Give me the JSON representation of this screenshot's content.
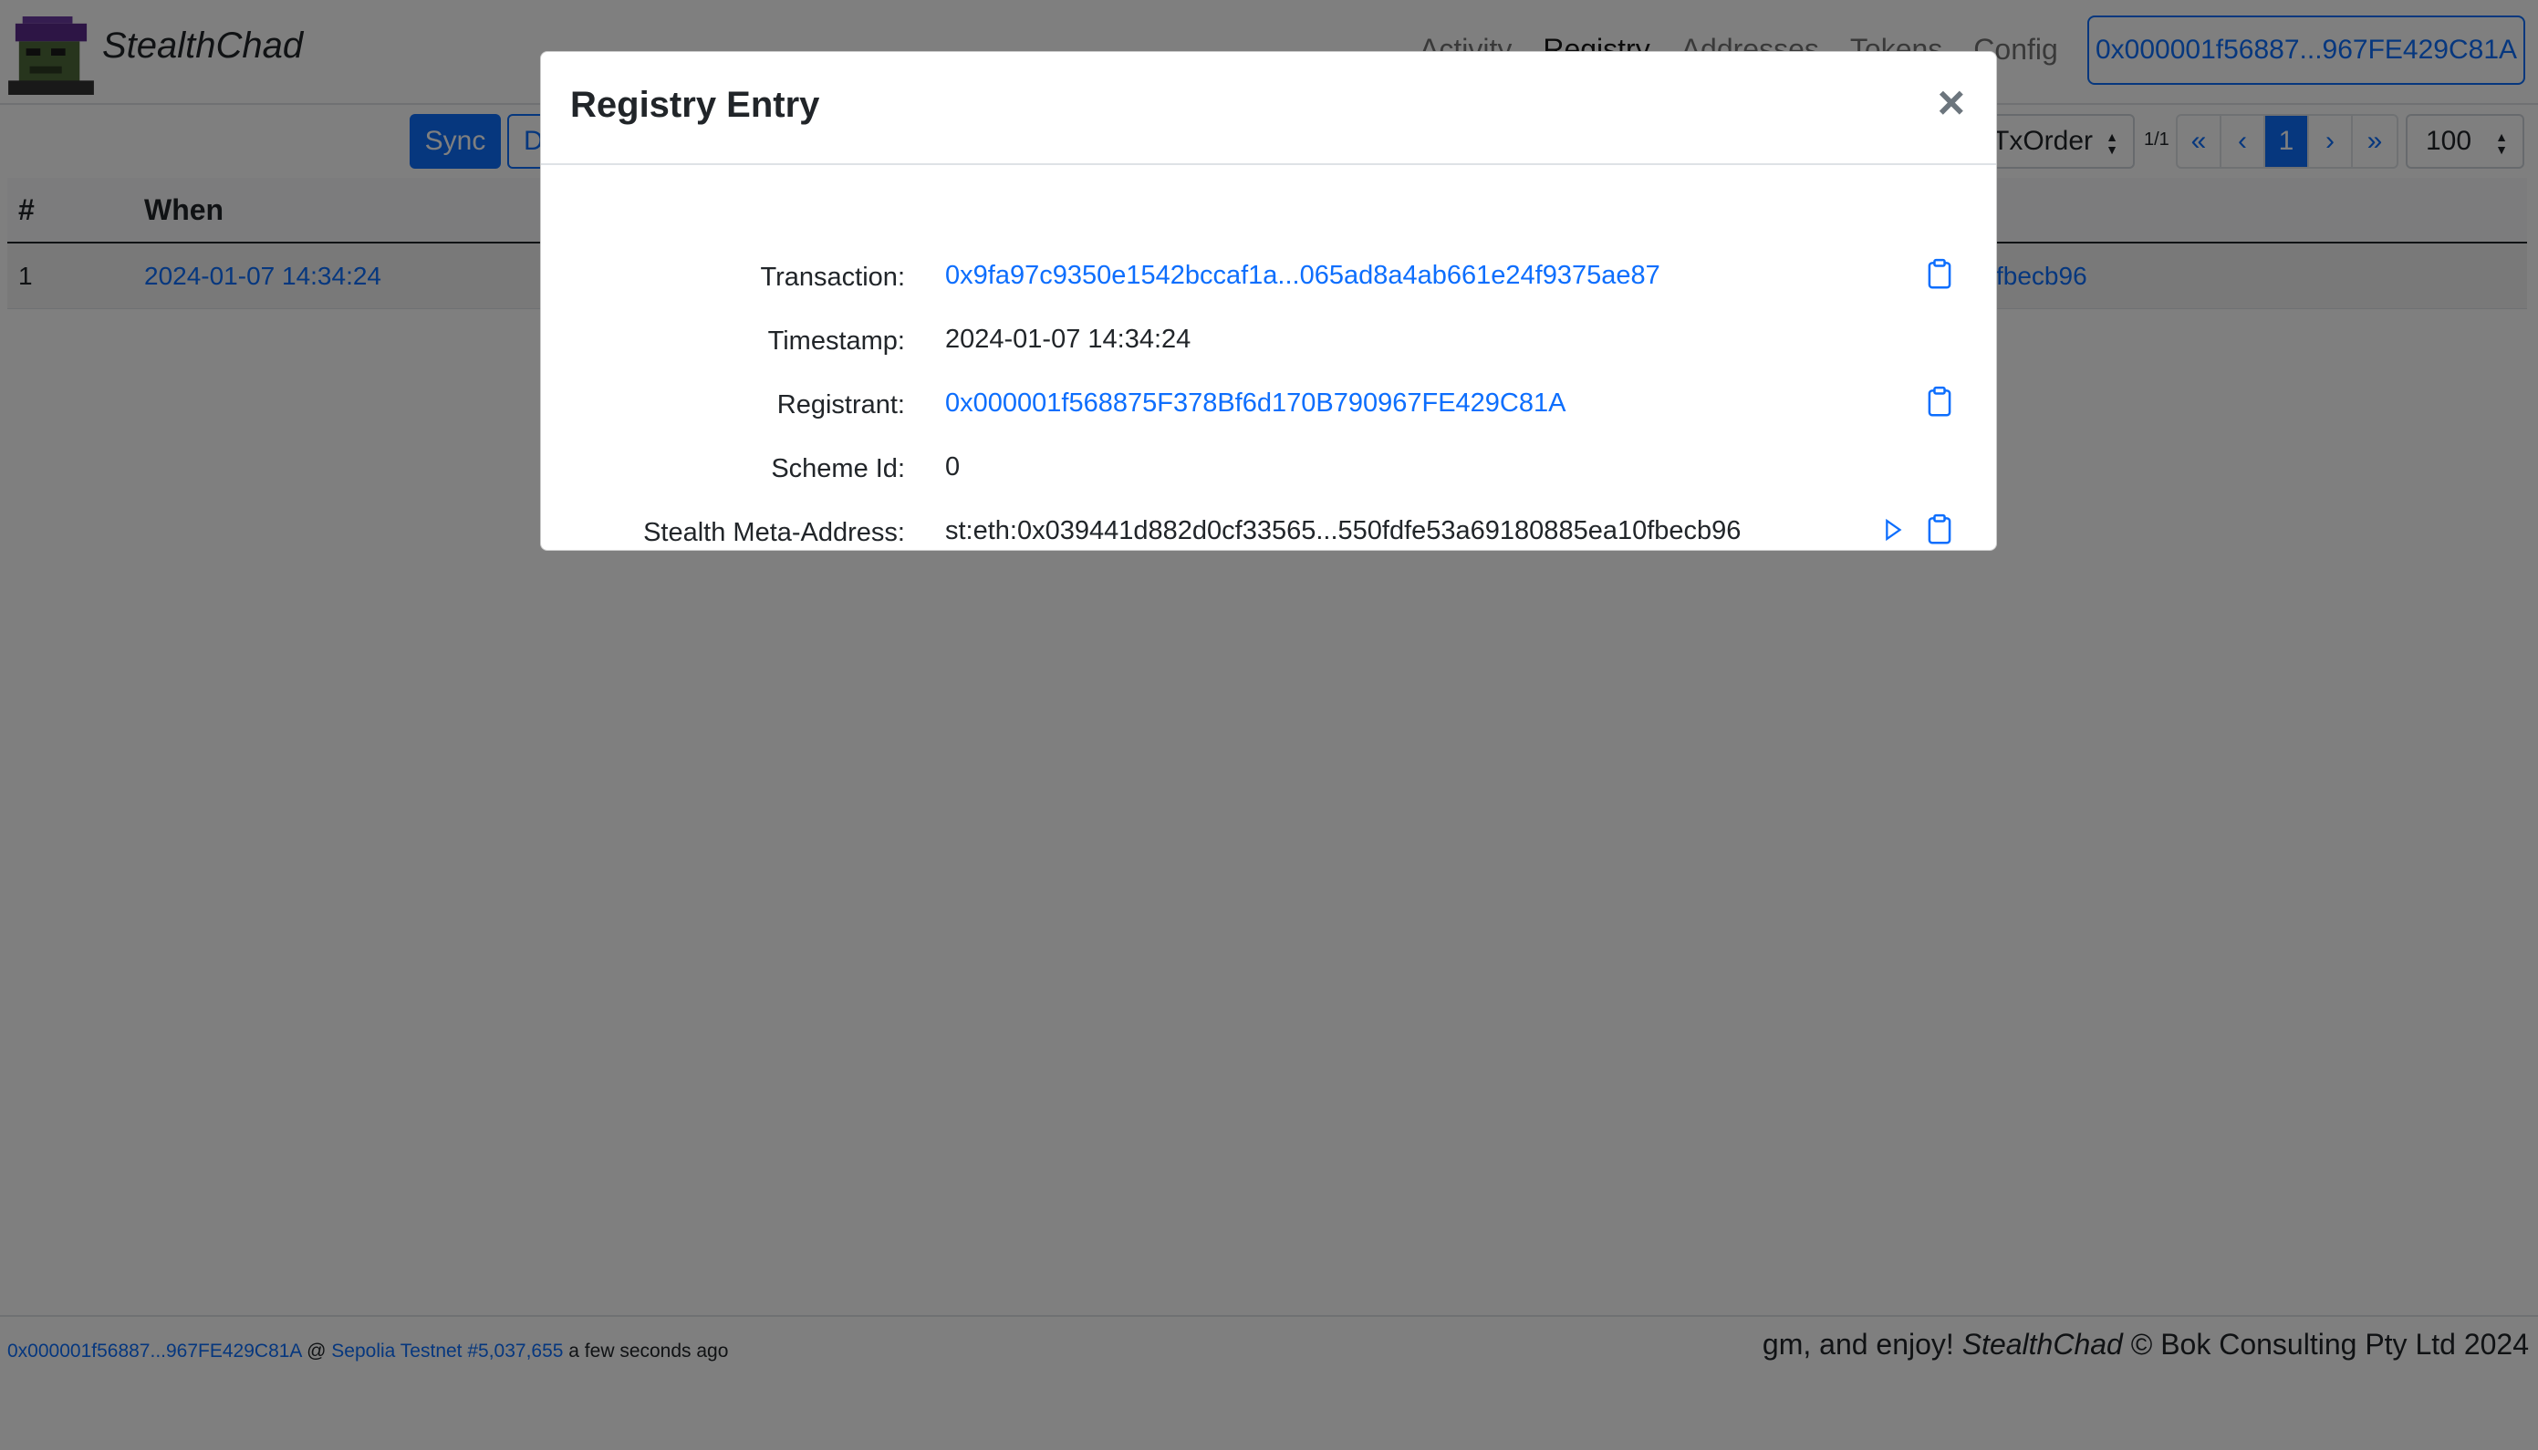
{
  "app": {
    "brand_name": "StealthChad",
    "nav": [
      "Activity",
      "Registry",
      "Addresses",
      "Tokens",
      "Config"
    ],
    "active_nav": "Registry",
    "account_button": "0x000001f56887...967FE429C81A"
  },
  "toolbar": {
    "sync_label": "Sync",
    "second_label": "D",
    "sort_value": "TxOrder",
    "page_info": "1/1",
    "pager": [
      "«",
      "‹",
      "1",
      "›",
      "»"
    ],
    "page_size": "100"
  },
  "table": {
    "headers": [
      "#",
      "When"
    ],
    "rows": [
      {
        "num": "1",
        "when": "2024-01-07 14:34:24",
        "tail": "fbecb96"
      }
    ]
  },
  "footer": {
    "account": "0x000001f56887...967FE429C81A",
    "at": "@",
    "network": "Sepolia Testnet #5,037,655",
    "age": "a few seconds ago",
    "greeting": "gm, and enjoy!",
    "brand": "StealthChad",
    "copyright": "© Bok Consulting Pty Ltd 2024"
  },
  "modal": {
    "title": "Registry Entry",
    "close": "×",
    "fields": {
      "transaction": {
        "label": "Transaction:",
        "value": "0x9fa97c9350e1542bccaf1a...065ad8a4ab661e24f9375ae87"
      },
      "timestamp": {
        "label": "Timestamp:",
        "value": "2024-01-07 14:34:24"
      },
      "registrant": {
        "label": "Registrant:",
        "value": "0x000001f568875F378Bf6d170B790967FE429C81A"
      },
      "scheme_id": {
        "label": "Scheme Id:",
        "value": "0"
      },
      "meta_address": {
        "label": "Stealth Meta-Address:",
        "value": "st:eth:0x039441d882d0cf33565...550fdfe53a69180885ea10fbecb96"
      }
    }
  },
  "colors": {
    "primary": "#0d6efd",
    "backdrop": "rgba(0,0,0,0.5)",
    "logo_hair": "#5a2a8a",
    "logo_face": "#4f6b3a"
  },
  "icons": [
    "clipboard-icon",
    "play-icon",
    "close-icon"
  ]
}
